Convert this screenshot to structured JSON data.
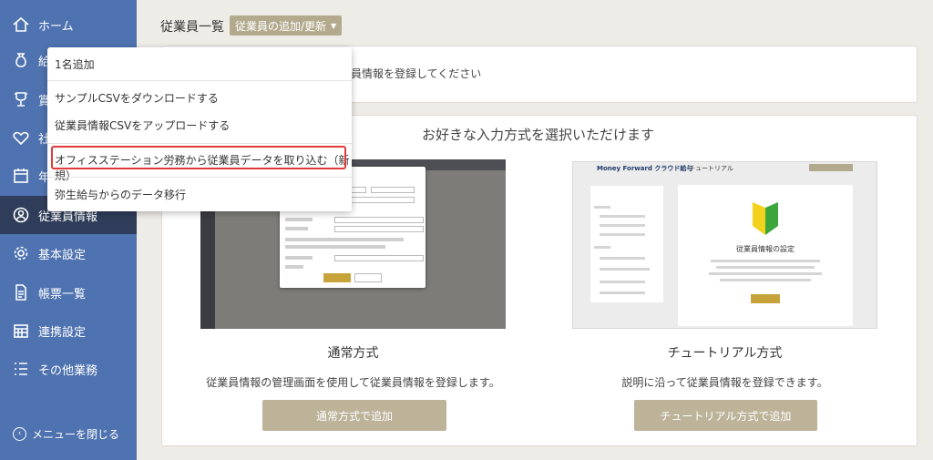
{
  "sidebar": {
    "items": [
      {
        "label": "ホーム",
        "icon": "home-icon"
      },
      {
        "label": "給",
        "icon": "money-bag-icon"
      },
      {
        "label": "賞",
        "icon": "trophy-icon"
      },
      {
        "label": "社",
        "icon": "heart-icon"
      },
      {
        "label": "年",
        "icon": "calendar-icon"
      },
      {
        "label": "従業員情報",
        "icon": "employee-icon"
      },
      {
        "label": "基本設定",
        "icon": "gear-icon"
      },
      {
        "label": "帳票一覧",
        "icon": "document-icon"
      },
      {
        "label": "連携設定",
        "icon": "calendar-grid-icon"
      },
      {
        "label": "その他業務",
        "icon": "list-icon"
      }
    ],
    "active_index": 5,
    "collapse_label": "メニューを閉じる"
  },
  "header": {
    "title": "従業員一覧",
    "dropdown_label": "従業員の追加/更新"
  },
  "info": {
    "text": "員情報を登録してください"
  },
  "dropdown_menu": {
    "items": [
      "1名追加",
      "サンプルCSVをダウンロードする",
      "従業員情報CSVをアップロードする",
      "オフィスステーション労務から従業員データを取り込む（新規）",
      "弥生給与からのデータ移行"
    ],
    "highlighted_index": 3
  },
  "main": {
    "title": "お好きな入力方式を選択いただけます",
    "methods": [
      {
        "name": "通常方式",
        "description": "従業員情報の管理画面を使用して従業員情報を登録します。",
        "button": "通常方式で追加"
      },
      {
        "name": "チュートリアル方式",
        "description": "説明に沿って従業員情報を登録できます。",
        "button": "チュートリアル方式で追加"
      }
    ]
  },
  "tutorial_preview": {
    "brand": "Money Forward クラウド給与",
    "tab": "チュートリアル",
    "heading": "従業員情報の設定"
  },
  "colors": {
    "sidebar": "#4f73b0",
    "sidebar_active": "#2f3d5a",
    "button": "#bcb399",
    "highlight": "#e23a3a"
  }
}
